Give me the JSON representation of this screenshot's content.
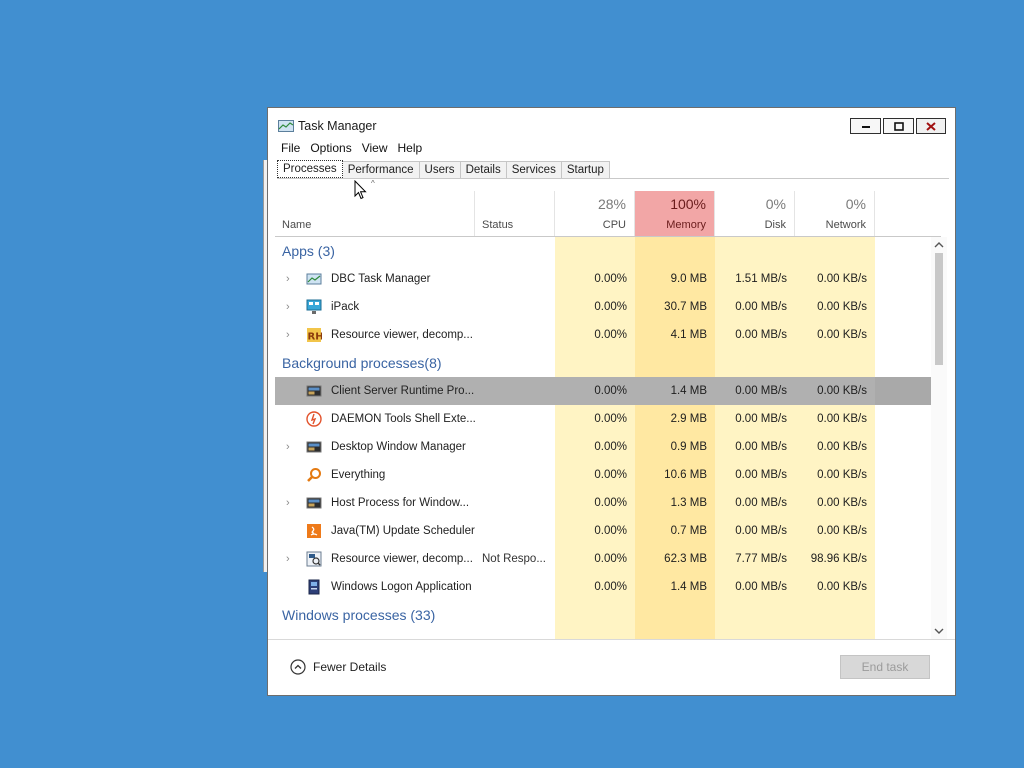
{
  "window": {
    "title": "Task Manager"
  },
  "menu": [
    "File",
    "Options",
    "View",
    "Help"
  ],
  "tabs": [
    "Processes",
    "Performance",
    "Users",
    "Details",
    "Services",
    "Startup"
  ],
  "active_tab": "Processes",
  "columns": {
    "name": "Name",
    "status": "Status",
    "cpu": {
      "pct": "28%",
      "label": "CPU"
    },
    "memory": {
      "pct": "100%",
      "label": "Memory"
    },
    "disk": {
      "pct": "0%",
      "label": "Disk"
    },
    "network": {
      "pct": "0%",
      "label": "Network"
    }
  },
  "groups": [
    {
      "title": "Apps (3)",
      "rows": [
        {
          "expand": true,
          "icon": "task-manager-icon",
          "name": "DBC Task Manager",
          "status": "",
          "cpu": "0.00%",
          "memory": "9.0 MB",
          "disk": "1.51 MB/s",
          "network": "0.00 KB/s"
        },
        {
          "expand": true,
          "icon": "ipack-icon",
          "name": "iPack",
          "status": "",
          "cpu": "0.00%",
          "memory": "30.7 MB",
          "disk": "0.00 MB/s",
          "network": "0.00 KB/s"
        },
        {
          "expand": true,
          "icon": "resource-hacker-icon",
          "name": "Resource viewer, decomp...",
          "status": "",
          "cpu": "0.00%",
          "memory": "4.1 MB",
          "disk": "0.00 MB/s",
          "network": "0.00 KB/s"
        }
      ]
    },
    {
      "title": "Background processes(8)",
      "rows": [
        {
          "expand": false,
          "selected": true,
          "icon": "system-process-icon",
          "name": "Client Server Runtime Pro...",
          "status": "",
          "cpu": "0.00%",
          "memory": "1.4 MB",
          "disk": "0.00 MB/s",
          "network": "0.00 KB/s"
        },
        {
          "expand": false,
          "icon": "daemon-tools-icon",
          "name": "DAEMON Tools Shell Exte...",
          "status": "",
          "cpu": "0.00%",
          "memory": "2.9 MB",
          "disk": "0.00 MB/s",
          "network": "0.00 KB/s"
        },
        {
          "expand": true,
          "icon": "system-process-icon",
          "name": "Desktop Window Manager",
          "status": "",
          "cpu": "0.00%",
          "memory": "0.9 MB",
          "disk": "0.00 MB/s",
          "network": "0.00 KB/s"
        },
        {
          "expand": false,
          "icon": "everything-search-icon",
          "name": "Everything",
          "status": "",
          "cpu": "0.00%",
          "memory": "10.6 MB",
          "disk": "0.00 MB/s",
          "network": "0.00 KB/s"
        },
        {
          "expand": true,
          "icon": "system-process-icon",
          "name": "Host Process for Window...",
          "status": "",
          "cpu": "0.00%",
          "memory": "1.3 MB",
          "disk": "0.00 MB/s",
          "network": "0.00 KB/s"
        },
        {
          "expand": false,
          "icon": "java-icon",
          "name": "Java(TM) Update Scheduler",
          "status": "",
          "cpu": "0.00%",
          "memory": "0.7 MB",
          "disk": "0.00 MB/s",
          "network": "0.00 KB/s"
        },
        {
          "expand": true,
          "icon": "resource-viewer-icon",
          "name": "Resource viewer, decomp...",
          "status": "Not Respo...",
          "cpu": "0.00%",
          "memory": "62.3 MB",
          "disk": "7.77 MB/s",
          "network": "98.96 KB/s"
        },
        {
          "expand": false,
          "icon": "winlogon-icon",
          "name": "Windows Logon Application",
          "status": "",
          "cpu": "0.00%",
          "memory": "1.4 MB",
          "disk": "0.00 MB/s",
          "network": "0.00 KB/s"
        }
      ]
    },
    {
      "title": "Windows processes (33)",
      "rows": []
    }
  ],
  "footer": {
    "fewer_details": "Fewer Details",
    "end_task": "End task"
  }
}
